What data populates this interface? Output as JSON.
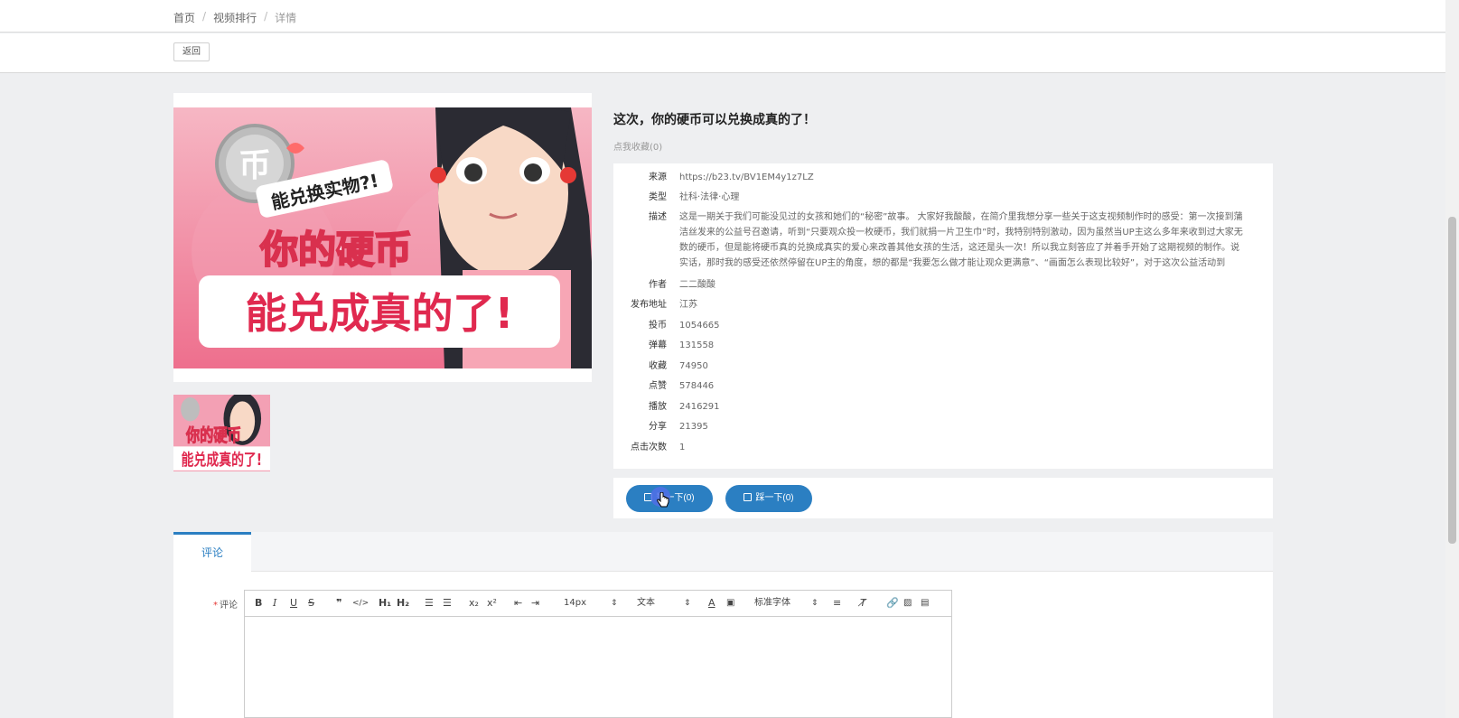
{
  "breadcrumb": {
    "home": "首页",
    "list": "视频排行",
    "current": "详情"
  },
  "back_label": "返回",
  "video": {
    "title": "这次，你的硬币可以兑换成真的了！",
    "fav_link": "点我收藏(0)",
    "cover_text": {
      "badge": "能兑换实物?!",
      "line1": "你的硬币",
      "line2": "能兑成真的了!",
      "coin_char": "币"
    }
  },
  "info": [
    {
      "key": "来源",
      "value": "https://b23.tv/BV1EM4y1z7LZ"
    },
    {
      "key": "类型",
      "value": "社科·法律·心理"
    },
    {
      "key": "描述",
      "value": "这是一期关于我们可能没见过的女孩和她们的“秘密”故事。 大家好我酸酸，在简介里我想分享一些关于这支视频制作时的感受：第一次接到蒲洁丝发来的公益号召邀请，听到“只要观众投一枚硬币，我们就捐一片卫生巾”时，我特别特别激动，因为虽然当UP主这么多年来收到过大家无数的硬币，但是能将硬币真的兑换成真实的爱心来改善其他女孩的生活，这还是头一次！所以我立刻答应了并着手开始了这期视频的制作。说实话，那时我的感受还依然停留在UP主的角度，想的都是“我要怎么做才能让观众更满意”、“画面怎么表现比较好”，对于这次公益活动到"
    },
    {
      "key": "作者",
      "value": "二二酸酸"
    },
    {
      "key": "发布地址",
      "value": "江苏"
    },
    {
      "key": "投币",
      "value": "1054665"
    },
    {
      "key": "弹幕",
      "value": "131558"
    },
    {
      "key": "收藏",
      "value": "74950"
    },
    {
      "key": "点赞",
      "value": "578446"
    },
    {
      "key": "播放",
      "value": "2416291"
    },
    {
      "key": "分享",
      "value": "21395"
    },
    {
      "key": "点击次数",
      "value": "1"
    }
  ],
  "votes": {
    "up_label": "赞一下(0)",
    "down_label": "踩一下(0)"
  },
  "tabs": {
    "comment": "评论"
  },
  "comment": {
    "label": "评论",
    "required_mark": "*",
    "font_size": "14px",
    "text_style": "文本",
    "font_family": "标准字体"
  },
  "colors": {
    "accent": "#2b7fc2",
    "page_bg": "#eeeff1"
  }
}
